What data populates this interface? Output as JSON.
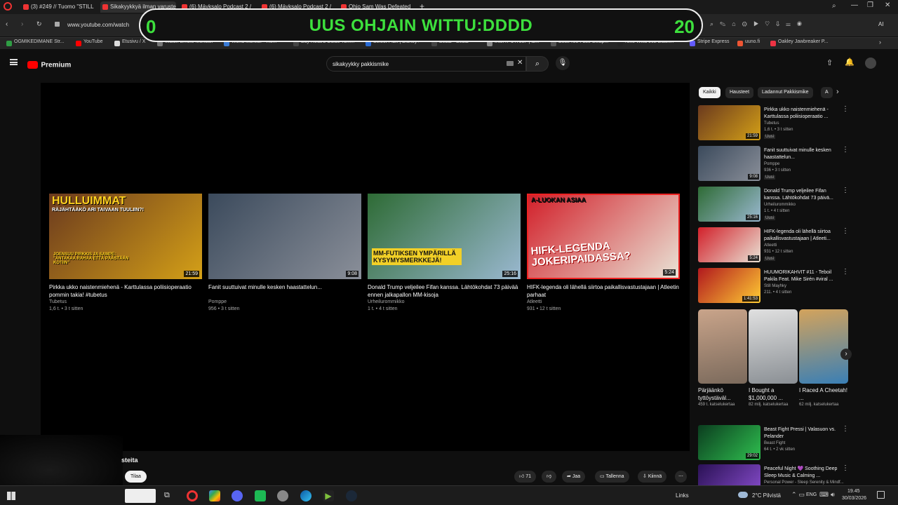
{
  "browser": {
    "tabs": [
      {
        "label": "(3) #249 // Tuomo \"STILL"
      },
      {
        "label": "Sikakyykkyä ilman varusteit"
      },
      {
        "label": "(6) Mäyksalo Podcast 2 /"
      },
      {
        "label": "(6) Mäyksalo Podcast 2 /"
      },
      {
        "label": "Ohio Sam Was Defeated"
      }
    ],
    "url": "www.youtube.com/watch",
    "bookmarks": [
      "OGMIKEDIMANE Str...",
      "YouTube",
      "Etusivu / X",
      "Watch Emote Monster",
      "World Monitor - Re...",
      "Buy Retard Guide Tom...",
      "Select Plan | Disney+",
      "Beatz - Beatz",
      "Intel i7-14700F | ib...",
      "BestFree Face Swap...",
      "Nike Willa 002 Black...",
      "Stripe Express",
      "uuno.fi",
      "Oakley Jawbreaker P..."
    ],
    "extension_label": "AI"
  },
  "overlay": {
    "left_count": "0",
    "title": "UUS OHJAIN WITTU:DDDD",
    "right_count": "20"
  },
  "youtube": {
    "logo": "Premium",
    "search_value": "sikakyykky pakkismike"
  },
  "endcards": [
    {
      "title": "Pirkka ukko naistenmiehenä - Karttulassa poliisioperaatio pommin takia! #tubetus",
      "channel": "Tubetus",
      "meta": "1,6 t. • 3 t sitten",
      "duration": "21:59",
      "overlay_top": "HULLUIMMAT",
      "overlay_sub": "RÄJÄHTÄÄKÖ ARI TAIVAAN TUULIIN?!",
      "overlay_bottom": "JOENSUU PIRKKIS JA SAMPE: \"ANTAKAA RAHAA ETTÄ PÄÄSTÄÄN KOTIIN\"",
      "colors": [
        "#6b3a1e",
        "#d4a017"
      ]
    },
    {
      "title": "Fanit suuttuivat minulle kesken haastattelun...",
      "channel": "Pomppe",
      "meta": "956 • 3 t sitten",
      "duration": "9:08",
      "colors": [
        "#3b4a5c",
        "#8a8f99"
      ]
    },
    {
      "title": "Donald Trump veljeilee Fifan kanssa. Lähtökohdat 73 päivää ennen jalkapallon MM-kisoja",
      "channel": "Urheilurommikko",
      "meta": "1 t. • 4 t sitten",
      "duration": "25:16",
      "overlay_bottom": "MM-FUTIKSEN YMPÄRILLÄ KYSYMYSMERKKEJÄ!",
      "colors": [
        "#2e6b35",
        "#9ab8d0"
      ]
    },
    {
      "title": "HIFK-legenda oli lähellä siirtoa paikallisvastustajaan | Atleetin parhaat",
      "channel": "Atleetti",
      "meta": "931 • 12 t sitten",
      "duration": "5:24",
      "overlay_top": "A-LUOKAN ASIAA",
      "overlay_bottom": "HIFK-LEGENDA JOKERIPAIDASSA?",
      "colors": [
        "#d2202a",
        "#e9e2d5"
      ]
    }
  ],
  "chips": [
    "Kaikki",
    "Hausteet",
    "Ladannut Pakkismike",
    "A"
  ],
  "sidebar": [
    {
      "title": "Pirkka ukko naistenmiehenä - Karttulassa poliisioperaatio ...",
      "channel": "Tubetus",
      "meta": "1,6 t. • 3 t sitten",
      "badge": "Uusi",
      "duration": "21:59",
      "colors": [
        "#6b3a1e",
        "#d4a017"
      ]
    },
    {
      "title": "Fanit suuttuivat minulle kesken haastattelun...",
      "channel": "Pomppe",
      "meta": "936 • 3 t sitten",
      "badge": "Uusi",
      "duration": "9:08",
      "colors": [
        "#3b4a5c",
        "#8a8f99"
      ]
    },
    {
      "title": "Donald Trump veljeilee Fifan kanssa. Lähtökohdat 73 päivä...",
      "channel": "Urheilurommikko",
      "meta": "1 t. • 4 t sitten",
      "badge": "Uusi",
      "duration": "25:16",
      "colors": [
        "#2e6b35",
        "#9ab8d0"
      ]
    },
    {
      "title": "HIFK-legenda oli lähellä siirtoa paikallisvastustajaan | Atleeti...",
      "channel": "Atleetti",
      "meta": "931 • 12 t sitten",
      "badge": "Uusi",
      "duration": "5:24",
      "colors": [
        "#d2202a",
        "#e9e2d5"
      ]
    },
    {
      "title": "HUUMORIKAHVIT #11 - Teboil Pakila Feat. Mike Sirén #viral ...",
      "channel": "Still Mayhky",
      "meta": "211. • 4 t sitten",
      "badge": "",
      "duration": "1:41:53",
      "colors": [
        "#b1181e",
        "#ffcc33"
      ]
    }
  ],
  "shorts": [
    {
      "title": "Pärjäänkö tyttöystäväl...",
      "meta": "459 t. katselukertaa",
      "colors": [
        "#7b6a5c",
        "#c9a48a"
      ]
    },
    {
      "title": "I Bought a $1,000,000 ...",
      "meta": "82 milj. katselukertaa",
      "colors": [
        "#8a8f94",
        "#e0e0e0"
      ]
    },
    {
      "title": "I Raced A Cheetah! ...",
      "meta": "62 milj. katselukertaa",
      "colors": [
        "#3a7fb5",
        "#d3a35c"
      ]
    }
  ],
  "sidebar_bottom": [
    {
      "title": "Beast Fight Pressi | Valasuon vs. Pelander",
      "channel": "Beast Fight",
      "meta": "64 t. • 2 vk sitten",
      "duration": "29:02",
      "colors": [
        "#0b3d1f",
        "#2fbf4f"
      ]
    },
    {
      "title": "Peaceful Night 💜 Soothing Deep Sleep Music & Calming ...",
      "channel": "Personal Power - Sleep Serenity & Mindf...",
      "meta": "",
      "duration": "",
      "colors": [
        "#2a1155",
        "#8b4fd1"
      ]
    }
  ],
  "below_player": {
    "channel_partial": "steita",
    "subscribe": "Tilaa",
    "likes": "71",
    "share": "Jaa",
    "save": "Tallenna",
    "clip": "Kiinnä"
  },
  "taskbar": {
    "links": "Links",
    "weather": "2°C Pilvistä",
    "lang": "ENG",
    "time": "19.45",
    "date": "30/03/2026"
  },
  "colors": {
    "accent_green": "#3de03d",
    "youtube_red": "#ff0000"
  }
}
